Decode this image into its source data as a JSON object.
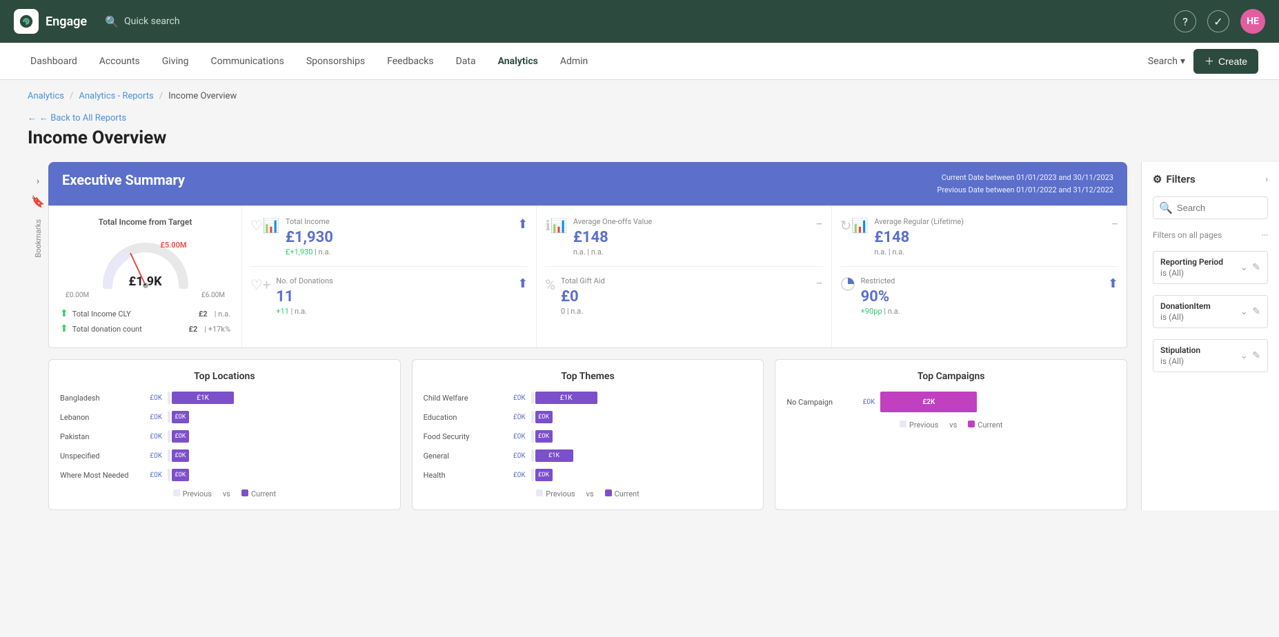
{
  "app": {
    "logo": "~",
    "title": "Engage",
    "quick_search": "Quick search"
  },
  "topbar_icons": {
    "help": "?",
    "tasks": "✓",
    "avatar": "HE"
  },
  "nav": {
    "items": [
      {
        "label": "Dashboard",
        "active": false
      },
      {
        "label": "Accounts",
        "active": false
      },
      {
        "label": "Giving",
        "active": false
      },
      {
        "label": "Communications",
        "active": false
      },
      {
        "label": "Sponsorships",
        "active": false
      },
      {
        "label": "Feedbacks",
        "active": false
      },
      {
        "label": "Data",
        "active": false
      },
      {
        "label": "Analytics",
        "active": true
      },
      {
        "label": "Admin",
        "active": false
      }
    ],
    "search_label": "Search",
    "create_label": "+ Create"
  },
  "breadcrumb": {
    "parts": [
      "Analytics",
      "Analytics - Reports",
      "Income Overview"
    ]
  },
  "page": {
    "back_label": "← Back to All Reports",
    "title": "Income Overview"
  },
  "executive_summary": {
    "title": "Executive Summary",
    "date_line1": "Current Date between 01/01/2023 and 30/11/2023",
    "date_line2": "Previous Date between 01/01/2022 and 31/12/2022"
  },
  "gauge": {
    "title": "Total Income from Target",
    "value": "£1.9K",
    "target": "£5.00M",
    "min": "£0.00M",
    "max": "£6.00M",
    "rows": [
      {
        "label": "Total Income CLY",
        "value": "£2",
        "change": "n.a."
      },
      {
        "label": "Total donation count",
        "value": "£2",
        "change": "+17k%"
      }
    ]
  },
  "metrics": [
    {
      "label": "Total Income",
      "value": "£1,930",
      "change_pos": "+1,930",
      "change_na": "n.a.",
      "icon": "heart-bar",
      "status": "up"
    },
    {
      "label": "Average One-offs Value",
      "value": "£148",
      "change_pos": "n.a.",
      "change_na": "n.a.",
      "icon": "info-bar",
      "status": "minus"
    },
    {
      "label": "Average Regular (Lifetime)",
      "value": "£148",
      "change_pos": "n.a.",
      "change_na": "n.a.",
      "icon": "refresh-bar",
      "status": "minus"
    }
  ],
  "metrics_bottom": [
    {
      "label": "No. of Donations",
      "value": "11",
      "change_pos": "+11",
      "change_na": "n.a.",
      "icon": "heart-plus",
      "status": "up"
    },
    {
      "label": "Total Gift Aid",
      "value": "£0",
      "change_pos": "0",
      "change_na": "n.a.",
      "icon": "percent",
      "status": "minus"
    },
    {
      "label": "Restricted",
      "value": "90%",
      "change_pos": "+90pp",
      "change_na": "n.a.",
      "icon": "pie",
      "status": "up"
    }
  ],
  "top_locations": {
    "title": "Top Locations",
    "rows": [
      {
        "label": "Bangladesh",
        "prev": "£0K",
        "curr": "£1K",
        "prev_width": 5,
        "curr_width": 60
      },
      {
        "label": "Lebanon",
        "prev": "£0K",
        "curr": "£0K",
        "prev_width": 5,
        "curr_width": 20
      },
      {
        "label": "Pakistan",
        "prev": "£0K",
        "curr": "£0K",
        "prev_width": 5,
        "curr_width": 20
      },
      {
        "label": "Unspecified",
        "prev": "£0K",
        "curr": "£0K",
        "prev_width": 5,
        "curr_width": 20
      },
      {
        "label": "Where Most Needed",
        "prev": "£0K",
        "curr": "£0K",
        "prev_width": 5,
        "curr_width": 20
      }
    ],
    "legend_prev": "Previous",
    "legend_vs": "vs",
    "legend_curr": "Current"
  },
  "top_themes": {
    "title": "Top Themes",
    "rows": [
      {
        "label": "Child Welfare",
        "prev": "£0K",
        "curr": "£1K",
        "prev_width": 5,
        "curr_width": 60
      },
      {
        "label": "Education",
        "prev": "£0K",
        "curr": "£0K",
        "prev_width": 5,
        "curr_width": 20
      },
      {
        "label": "Food Security",
        "prev": "£0K",
        "curr": "£0K",
        "prev_width": 5,
        "curr_width": 20
      },
      {
        "label": "General",
        "prev": "£0K",
        "curr": "£1K",
        "prev_width": 5,
        "curr_width": 40
      },
      {
        "label": "Health",
        "prev": "£0K",
        "curr": "£0K",
        "prev_width": 5,
        "curr_width": 20
      }
    ],
    "legend_prev": "Previous",
    "legend_vs": "vs",
    "legend_curr": "Current"
  },
  "top_campaigns": {
    "title": "Top Campaigns",
    "rows": [
      {
        "label": "No Campaign",
        "prev": "£0K",
        "curr": "£2K",
        "curr_width": 90
      }
    ],
    "legend_prev": "Previous",
    "legend_vs": "vs",
    "legend_curr": "Current"
  },
  "filters": {
    "title": "Filters",
    "search_placeholder": "Search",
    "section_label": "Filters on all pages",
    "items": [
      {
        "label": "Reporting Period",
        "value": "is (All)"
      },
      {
        "label": "DonationItem",
        "value": "is (All)"
      },
      {
        "label": "Stipulation",
        "value": "is (All)"
      }
    ]
  },
  "bookmarks": {
    "label": "Bookmarks"
  }
}
